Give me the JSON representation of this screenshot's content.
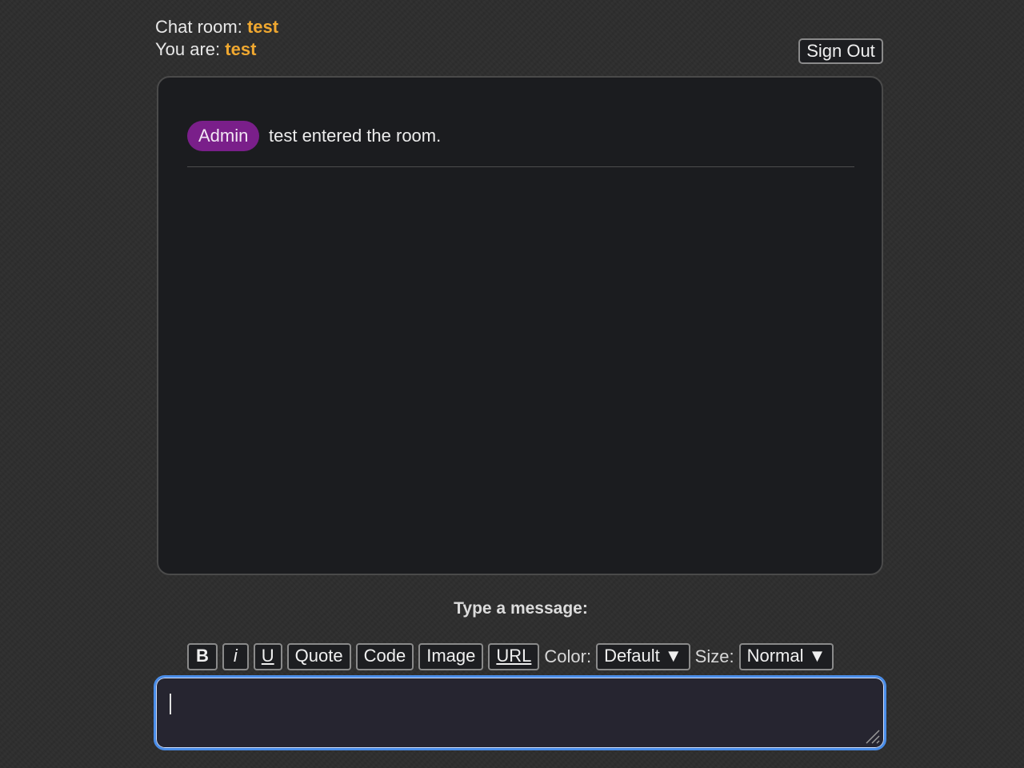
{
  "header": {
    "room_label": "Chat room:",
    "room_name": "test",
    "user_label": "You are:",
    "user_name": "test",
    "signout_label": "Sign Out"
  },
  "messages": [
    {
      "author": "Admin",
      "text": "test entered the room.",
      "badge_color": "#7a1f8a"
    }
  ],
  "composer": {
    "label": "Type a message:",
    "toolbar": {
      "bold": "B",
      "italic": "i",
      "underline": "U",
      "quote": "Quote",
      "code": "Code",
      "image": "Image",
      "url": "URL",
      "color_label": "Color:",
      "color_value": "Default ▼",
      "size_label": "Size:",
      "size_value": "Normal ▼"
    },
    "input_value": ""
  },
  "colors": {
    "accent": "#f0a830",
    "focus_ring": "#4a8de8",
    "admin_badge": "#7a1f8a"
  }
}
